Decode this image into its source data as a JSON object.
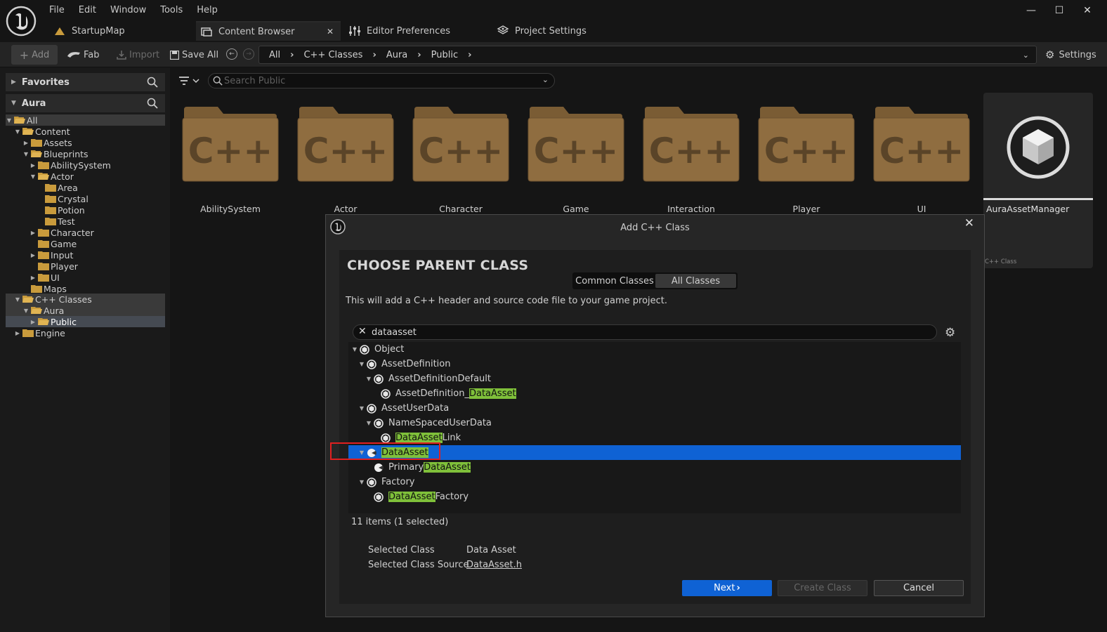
{
  "menu": [
    "File",
    "Edit",
    "Window",
    "Tools",
    "Help"
  ],
  "tabs": {
    "map": "StartupMap",
    "content_browser": "Content Browser",
    "editor_prefs": "Editor Preferences",
    "project_settings": "Project Settings"
  },
  "toolbar": {
    "add": "Add",
    "fab": "Fab",
    "import": "Import",
    "save_all": "Save All",
    "settings": "Settings"
  },
  "breadcrumb": [
    "All",
    "C++ Classes",
    "Aura",
    "Public"
  ],
  "left_panel": {
    "favorites": "Favorites",
    "project": "Aura",
    "tree": [
      "All",
      "Content",
      "Assets",
      "Blueprints",
      "AbilitySystem",
      "Actor",
      "Area",
      "Crystal",
      "Potion",
      "Test",
      "Character",
      "Game",
      "Input",
      "Player",
      "UI",
      "Maps",
      "C++ Classes",
      "Aura",
      "Public",
      "Engine"
    ]
  },
  "search": {
    "placeholder": "Search Public"
  },
  "folders": [
    "AbilitySystem",
    "Actor",
    "Character",
    "Game",
    "Interaction",
    "Player",
    "UI"
  ],
  "folder_glyph": "C++",
  "asset": {
    "name": "AuraAssetManager",
    "type": "C++ Class"
  },
  "dialog": {
    "title": "Add C++ Class",
    "heading": "CHOOSE PARENT CLASS",
    "tab_common": "Common Classes",
    "tab_all": "All Classes",
    "description": "This will add a C++ header and source code file to your game project.",
    "filter": "dataasset",
    "tree": [
      {
        "pre": "Object",
        "hl": "",
        "post": ""
      },
      {
        "pre": "AssetDefinition",
        "hl": "",
        "post": ""
      },
      {
        "pre": "AssetDefinitionDefault",
        "hl": "",
        "post": ""
      },
      {
        "pre": "AssetDefinition_",
        "hl": "DataAsset",
        "post": ""
      },
      {
        "pre": "AssetUserData",
        "hl": "",
        "post": ""
      },
      {
        "pre": "NameSpacedUserData",
        "hl": "",
        "post": ""
      },
      {
        "pre": "",
        "hl": "DataAsset",
        "post": "Link"
      },
      {
        "pre": "",
        "hl": "DataAsset",
        "post": ""
      },
      {
        "pre": "Primary",
        "hl": "DataAsset",
        "post": ""
      },
      {
        "pre": "Factory",
        "hl": "",
        "post": ""
      },
      {
        "pre": "",
        "hl": "DataAsset",
        "post": "Factory"
      }
    ],
    "count": "11 items (1 selected)",
    "selected_class_label": "Selected Class",
    "selected_class_value": "Data Asset",
    "selected_source_label": "Selected Class Source",
    "selected_source_value": "DataAsset.h",
    "next": "Next",
    "create": "Create Class",
    "cancel": "Cancel"
  },
  "colors": {
    "accent": "#0f62d4",
    "highlight": "#7fc03a",
    "folder": "#8a6a3e"
  }
}
